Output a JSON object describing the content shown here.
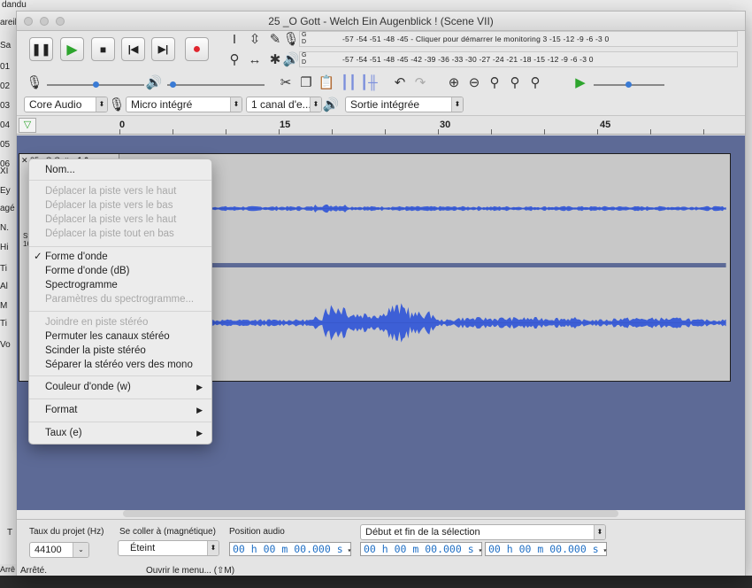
{
  "background": {
    "title": "dandu",
    "sidebar_items": [
      "areil",
      "Sa",
      "01",
      "02",
      "03",
      "04",
      "05",
      "06",
      "XI",
      "Ey",
      "agé",
      "N.",
      "Hi",
      "Ti",
      "Al",
      "M",
      "Ti",
      "Vo"
    ],
    "status_left": "Arrê",
    "bottom_t": "T"
  },
  "window": {
    "title": "25 _O Gott - Welch Ein Augenblick ! (Scene VII)"
  },
  "meters": {
    "record_scale": "-57  -54  -51  -48  -45  -  Cliquer pour démarrer le monitoring  3  -15  -12  -9   -6   -3   0",
    "play_scale": "-57  -54  -51  -48  -45  -42  -39  -36  -33  -30  -27  -24  -21  -18  -15  -12  -9   -6   -3   0",
    "lr_g": "G",
    "lr_d": "D"
  },
  "devices": {
    "host": "Core Audio",
    "input": "Micro intégré",
    "channels": "1 canal d'e...",
    "output": "Sortie intégrée"
  },
  "ruler": {
    "ticks": [
      "0",
      "15",
      "30",
      "45"
    ]
  },
  "track": {
    "name_fragment": "25 _O Gott",
    "gain": "1.0",
    "side_fragment_a": "St",
    "side_fragment_b": "16"
  },
  "menu": {
    "items": [
      {
        "label": "Nom...",
        "enabled": true
      },
      {
        "label": "Déplacer la piste vers le haut",
        "enabled": false
      },
      {
        "label": "Déplacer la piste vers le bas",
        "enabled": false
      },
      {
        "label": "Déplacer la piste vers le haut",
        "enabled": false
      },
      {
        "label": "Déplacer la piste tout en bas",
        "enabled": false
      },
      {
        "label": "Forme d'onde",
        "enabled": true,
        "checked": true
      },
      {
        "label": "Forme d'onde (dB)",
        "enabled": true
      },
      {
        "label": "Spectrogramme",
        "enabled": true
      },
      {
        "label": "Paramètres du spectrogramme...",
        "enabled": false
      },
      {
        "label": "Joindre en piste stéréo",
        "enabled": false
      },
      {
        "label": "Permuter les canaux stéréo",
        "enabled": true
      },
      {
        "label": "Scinder la piste stéréo",
        "enabled": true
      },
      {
        "label": "Séparer la stéréo vers des mono",
        "enabled": true
      },
      {
        "label": "Couleur d'onde (w)",
        "enabled": true,
        "submenu": true
      },
      {
        "label": "Format",
        "enabled": true,
        "submenu": true
      },
      {
        "label": "Taux (e)",
        "enabled": true,
        "submenu": true
      }
    ]
  },
  "bottom": {
    "project_rate_label": "Taux du projet (Hz)",
    "project_rate_value": "44100",
    "snap_label": "Se coller à (magnétique)",
    "snap_value": "Éteint",
    "audio_pos_label": "Position audio",
    "audio_pos_value": "00 h 00 m 00.000 s",
    "selection_label": "Début et fin de la sélection",
    "sel_start": "00 h 00 m 00.000 s",
    "sel_end": "00 h 00 m 00.000 s",
    "status": "Arrêté.",
    "status_hint": "Ouvrir le menu... (⇧M)"
  },
  "colors": {
    "wave": "#3d5fd6",
    "track_bg": "#5d6a96",
    "record": "#e0262e",
    "play": "#2ea52e"
  }
}
